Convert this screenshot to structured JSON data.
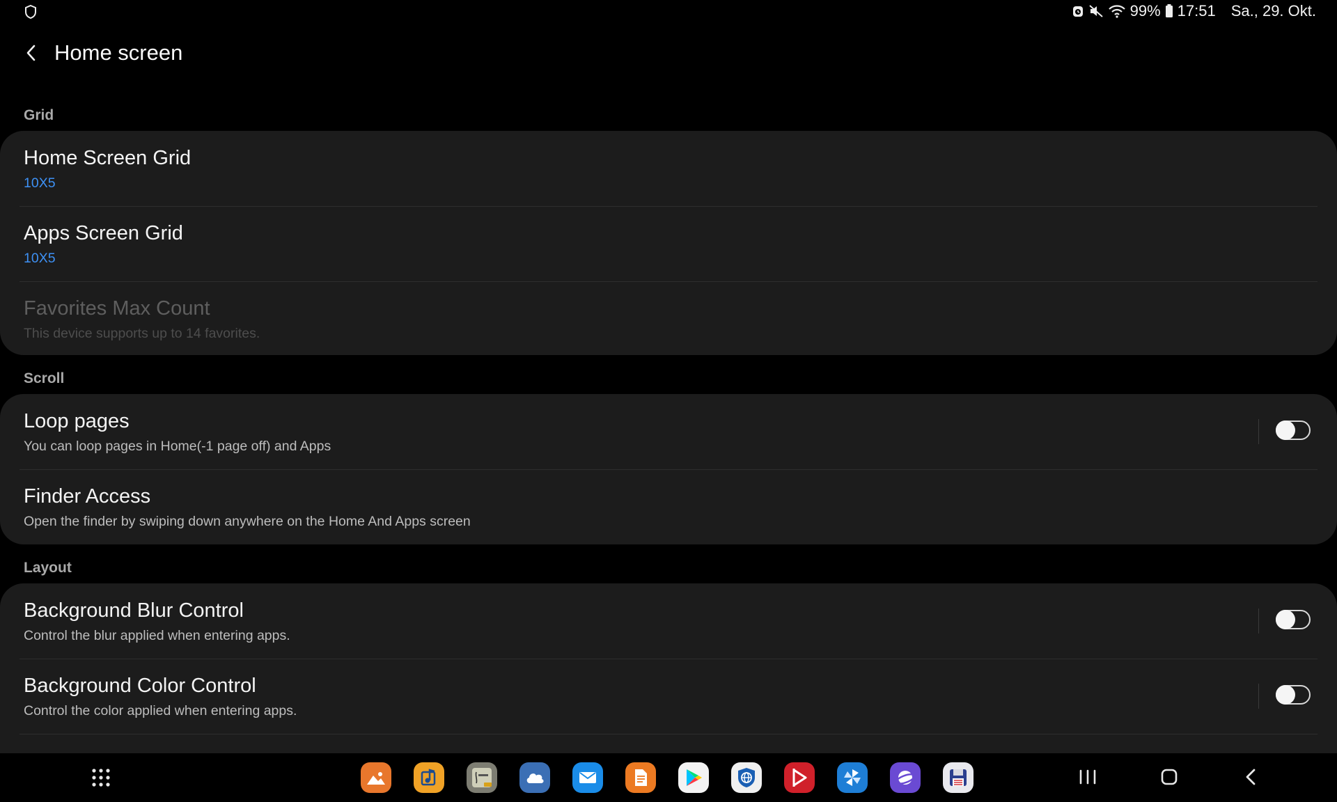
{
  "status_bar": {
    "battery": "99%",
    "time": "17:51",
    "date": "Sa., 29. Okt.",
    "icons": [
      "shield-icon",
      "alarm-icon",
      "mute-icon",
      "wifi-icon",
      "battery-icon"
    ]
  },
  "header": {
    "title": "Home screen",
    "back_icon": "back-chevron-icon"
  },
  "sections": {
    "grid": {
      "header": "Grid",
      "home_grid": {
        "title": "Home Screen Grid",
        "value": "10X5"
      },
      "apps_grid": {
        "title": "Apps Screen Grid",
        "value": "10X5"
      },
      "favorites": {
        "title": "Favorites Max Count",
        "subtitle": "This device supports up to 14 favorites.",
        "enabled": false
      }
    },
    "scroll": {
      "header": "Scroll",
      "loop_pages": {
        "title": "Loop pages",
        "subtitle": "You can loop pages in Home(-1 page off) and Apps",
        "on": false
      },
      "finder_access": {
        "title": "Finder Access",
        "subtitle": "Open the finder by swiping down anywhere on the Home And Apps screen"
      }
    },
    "layout": {
      "header": "Layout",
      "bg_blur": {
        "title": "Background Blur Control",
        "subtitle": "Control the blur applied when entering apps.",
        "on": false
      },
      "bg_color": {
        "title": "Background Color Control",
        "subtitle": "Control the color applied when entering apps.",
        "on": false
      }
    }
  },
  "nav_bar": {
    "apps_button_icon": "apps-grid-icon",
    "dock_apps": [
      "gallery",
      "music-player",
      "calculator-pro",
      "cloud",
      "email",
      "documents",
      "play-store",
      "web-browser",
      "media-player",
      "pinwheel",
      "internet",
      "save-disk"
    ],
    "buttons": [
      "recents-icon",
      "home-icon",
      "back-icon"
    ]
  },
  "colors": {
    "accent_blue": "#3e91f5",
    "background": "#000000",
    "card": "#1c1c1c"
  }
}
